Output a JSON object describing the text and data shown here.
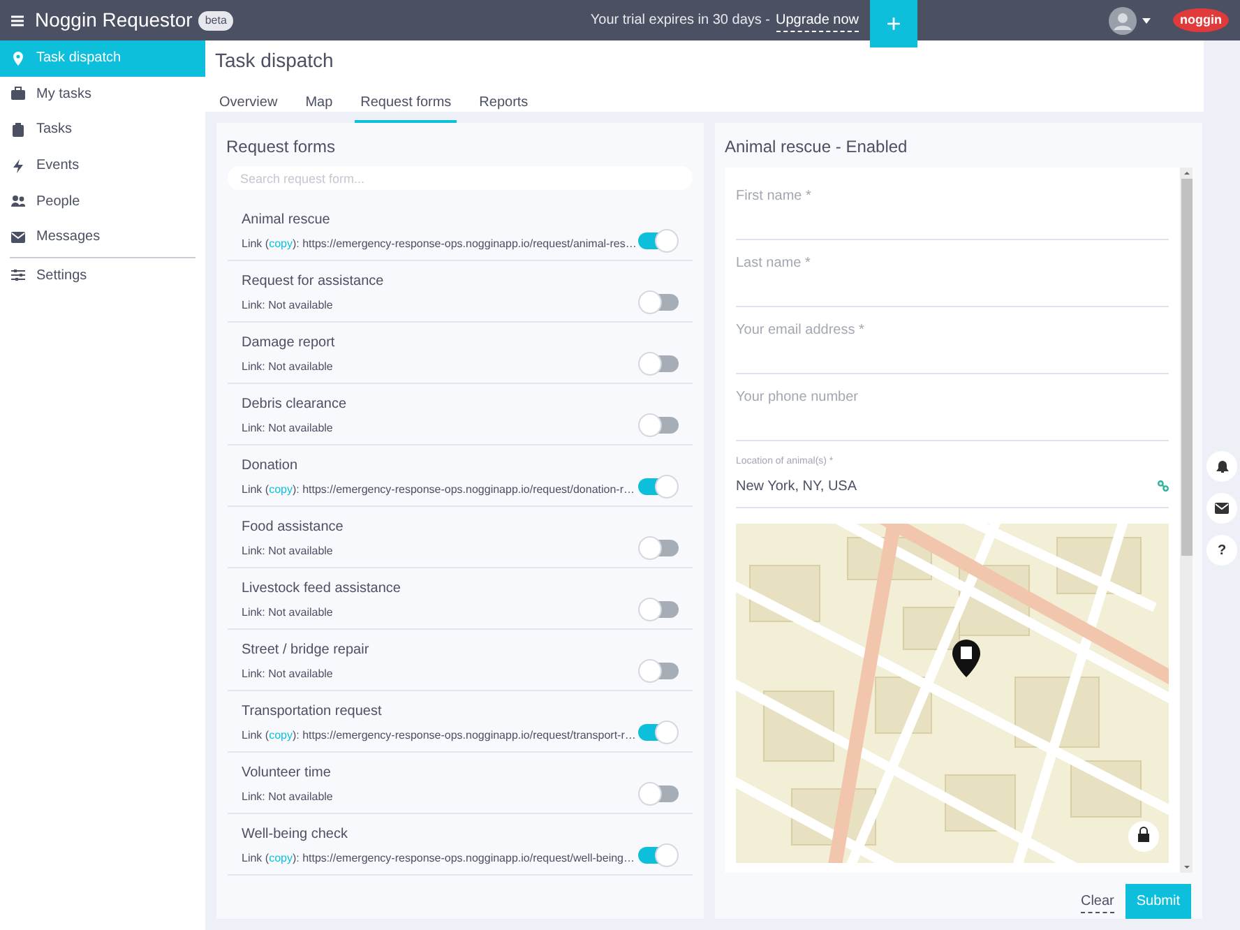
{
  "topbar": {
    "title": "Noggin Requestor",
    "badge": "beta",
    "trial_text": "Your trial expires in 30 days -",
    "upgrade_link": "Upgrade now",
    "add_button": "+",
    "logo": "noggin"
  },
  "sidebar": {
    "items": [
      {
        "label": "Task dispatch",
        "selected": true
      },
      {
        "label": "My tasks",
        "selected": false
      },
      {
        "label": "Tasks",
        "selected": false
      },
      {
        "label": "Events",
        "selected": false
      },
      {
        "label": "People",
        "selected": false
      },
      {
        "label": "Messages",
        "selected": false
      }
    ],
    "footer_items": [
      {
        "label": "Settings",
        "selected": false
      }
    ]
  },
  "page": {
    "title": "Task dispatch",
    "tabs": [
      {
        "label": "Overview",
        "selected": false
      },
      {
        "label": "Map",
        "selected": false
      },
      {
        "label": "Request forms",
        "selected": true
      },
      {
        "label": "Reports",
        "selected": false
      }
    ]
  },
  "request_forms": {
    "title": "Request forms",
    "search": {
      "placeholder": "Search request form..."
    },
    "items": [
      {
        "name": "Animal rescue",
        "enabled": true,
        "link": {
          "before": "Link (",
          "copy": "copy",
          "after": "): https://emergency-response-ops.nogginapp.io/request/animal-res…"
        }
      },
      {
        "name": "Request for assistance",
        "enabled": false,
        "link_text": "Link: Not available"
      },
      {
        "name": "Damage report",
        "enabled": false,
        "link_text": "Link: Not available"
      },
      {
        "name": "Debris clearance",
        "enabled": false,
        "link_text": "Link: Not available"
      },
      {
        "name": "Donation",
        "enabled": true,
        "link": {
          "before": "Link (",
          "copy": "copy",
          "after": "): https://emergency-response-ops.nogginapp.io/request/donation-r…"
        }
      },
      {
        "name": "Food assistance",
        "enabled": false,
        "link_text": "Link: Not available"
      },
      {
        "name": "Livestock feed assistance",
        "enabled": false,
        "link_text": "Link: Not available"
      },
      {
        "name": "Street / bridge repair",
        "enabled": false,
        "link_text": "Link: Not available"
      },
      {
        "name": "Transportation request",
        "enabled": true,
        "link": {
          "before": "Link (",
          "copy": "copy",
          "after": "): https://emergency-response-ops.nogginapp.io/request/transport-r…"
        }
      },
      {
        "name": "Volunteer time",
        "enabled": false,
        "link_text": "Link: Not available"
      },
      {
        "name": "Well-being check",
        "enabled": true,
        "link": {
          "before": "Link (",
          "copy": "copy",
          "after": "): https://emergency-response-ops.nogginapp.io/request/well-being…"
        }
      }
    ]
  },
  "form_preview": {
    "title": "Animal rescue - Enabled",
    "fields": [
      {
        "kind": "text",
        "placeholder": "First name *"
      },
      {
        "kind": "text",
        "placeholder": "Last name *"
      },
      {
        "kind": "text",
        "placeholder": "Your email address *"
      },
      {
        "kind": "text",
        "placeholder": "Your phone number"
      },
      {
        "kind": "location",
        "label": "Location of animal(s) *",
        "value": "New York, NY, USA"
      },
      {
        "kind": "map"
      }
    ],
    "clear_button": "Clear",
    "submit_button": "Submit"
  },
  "help_button": "?"
}
